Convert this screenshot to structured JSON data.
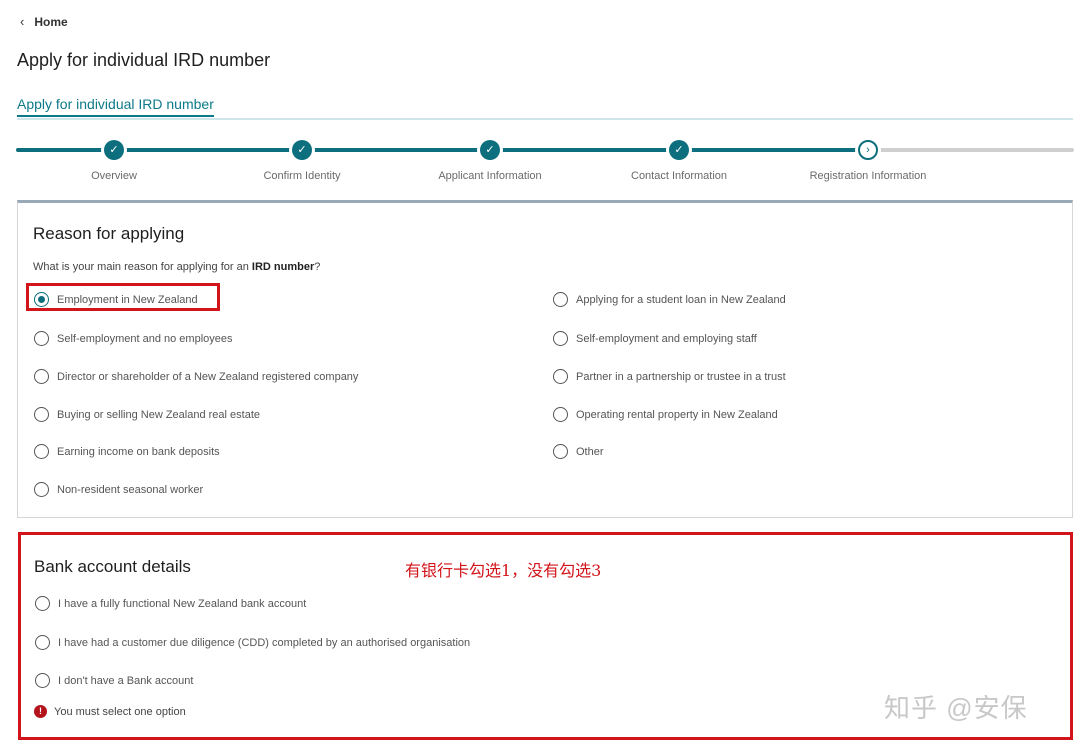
{
  "breadcrumb": {
    "home_label": "Home"
  },
  "page": {
    "title": "Apply for individual IRD number",
    "subtitle": "Apply for individual IRD number"
  },
  "stepper": {
    "steps": [
      {
        "label": "Overview",
        "status": "done"
      },
      {
        "label": "Confirm Identity",
        "status": "done"
      },
      {
        "label": "Applicant Information",
        "status": "done"
      },
      {
        "label": "Contact Information",
        "status": "done"
      },
      {
        "label": "Registration Information",
        "status": "current"
      }
    ]
  },
  "reason": {
    "heading": "Reason for applying",
    "question_prefix": "What is your main reason for applying for an ",
    "question_bold": "IRD number",
    "question_suffix": "?",
    "options": [
      {
        "label": "Employment in New Zealand",
        "checked": true
      },
      {
        "label": "Applying for a student loan in New Zealand",
        "checked": false
      },
      {
        "label": "Self-employment and no employees",
        "checked": false
      },
      {
        "label": "Self-employment and employing staff",
        "checked": false
      },
      {
        "label": "Director or shareholder of a New Zealand registered company",
        "checked": false
      },
      {
        "label": "Partner in a partnership or trustee in a trust",
        "checked": false
      },
      {
        "label": "Buying or selling New Zealand real estate",
        "checked": false
      },
      {
        "label": "Operating rental property in New Zealand",
        "checked": false
      },
      {
        "label": "Earning income on bank deposits",
        "checked": false
      },
      {
        "label": "Other",
        "checked": false
      },
      {
        "label": "Non-resident seasonal worker",
        "checked": false
      }
    ]
  },
  "bank": {
    "heading": "Bank account details",
    "annotation": "有银行卡勾选1，没有勾选3",
    "options": [
      {
        "label": "I have a fully functional New Zealand bank account",
        "checked": false
      },
      {
        "label": "I have had a customer due diligence (CDD) completed by an authorised organisation",
        "checked": false
      },
      {
        "label": "I don't have a Bank account",
        "checked": false
      }
    ],
    "error_message": "You must select one option"
  },
  "watermark": "知乎 @安保",
  "colors": {
    "accent": "#0d6f7e",
    "annotation": "#d2151b",
    "error": "#b3131a"
  }
}
